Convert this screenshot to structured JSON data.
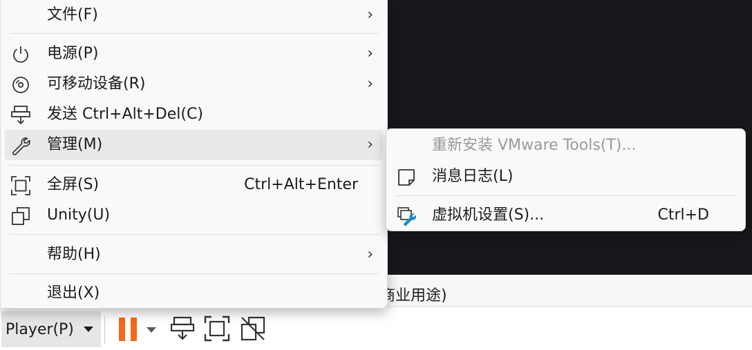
{
  "status_bar": {
    "text": "商业用途)"
  },
  "toolbar": {
    "player_label": "Player(P)",
    "icons": [
      "pause-icon",
      "send-ctrl-alt-del-icon",
      "fullscreen-icon",
      "unity-icon"
    ],
    "accent_color": "#f26a1b"
  },
  "menu": {
    "items": [
      {
        "label": "文件(F)",
        "has_submenu": true
      },
      {
        "label": "电源(P)",
        "has_submenu": true,
        "icon": "power-icon"
      },
      {
        "label": "可移动设备(R)",
        "has_submenu": true,
        "icon": "removable-device-icon"
      },
      {
        "label": "发送 Ctrl+Alt+Del(C)",
        "icon": "send-ctrl-alt-del-icon"
      },
      {
        "label": "管理(M)",
        "has_submenu": true,
        "icon": "wrench-icon",
        "highlighted": true
      },
      {
        "label": "全屏(S)",
        "shortcut": "Ctrl+Alt+Enter",
        "icon": "fullscreen-icon"
      },
      {
        "label": "Unity(U)",
        "icon": "unity-icon"
      },
      {
        "label": "帮助(H)",
        "has_submenu": true
      },
      {
        "label": "退出(X)"
      }
    ],
    "arrow": "›"
  },
  "submenu": {
    "items": [
      {
        "label": "重新安装 VMware Tools(T)...",
        "disabled": true
      },
      {
        "label": "消息日志(L)",
        "icon": "message-log-icon"
      },
      {
        "label": "虚拟机设置(S)...",
        "shortcut": "Ctrl+D",
        "icon": "vm-settings-icon"
      }
    ]
  }
}
